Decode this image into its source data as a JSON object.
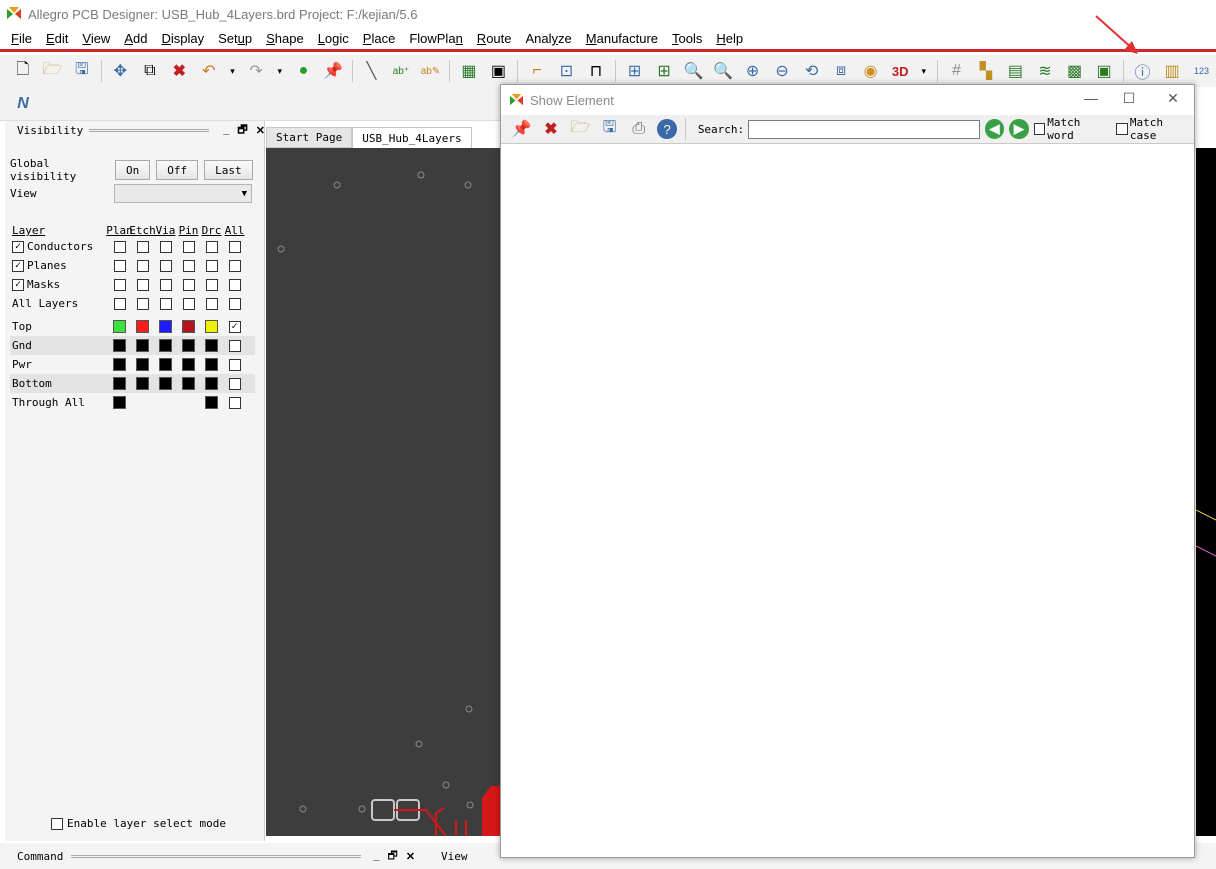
{
  "window": {
    "title": "Allegro PCB Designer: USB_Hub_4Layers.brd  Project: F:/kejian/5.6"
  },
  "menu": [
    {
      "label": "File",
      "u": "F"
    },
    {
      "label": "Edit",
      "u": "E"
    },
    {
      "label": "View",
      "u": "V"
    },
    {
      "label": "Add",
      "u": "A"
    },
    {
      "label": "Display",
      "u": "D"
    },
    {
      "label": "Setup",
      "u": "u"
    },
    {
      "label": "Shape",
      "u": "S"
    },
    {
      "label": "Logic",
      "u": "L"
    },
    {
      "label": "Place",
      "u": "P"
    },
    {
      "label": "FlowPlan",
      "u": "n"
    },
    {
      "label": "Route",
      "u": "R"
    },
    {
      "label": "Analyze",
      "u": "y"
    },
    {
      "label": "Manufacture",
      "u": "M"
    },
    {
      "label": "Tools",
      "u": "T"
    },
    {
      "label": "Help",
      "u": "H"
    }
  ],
  "toolbar_icons": [
    "new-file",
    "open-folder",
    "save",
    "move",
    "copy",
    "delete",
    "undo",
    "dropdown",
    "redo",
    "dropdown",
    "color-ball",
    "pin",
    "line",
    "add-text",
    "edit-text",
    "properties",
    "component",
    "connect",
    "route-box",
    "route-step",
    "grid-a",
    "grid-b",
    "zoom-fit",
    "zoom-in",
    "zoom-plus",
    "zoom-minus",
    "zoom-prev",
    "zoom-box",
    "refresh",
    "3d",
    "grid",
    "layers",
    "layers-b",
    "stack",
    "panel",
    "panel-b",
    "info",
    "show-element",
    "ruler"
  ],
  "toolbar_3d_label": "3D",
  "toolbar_ruler_label": "123",
  "visibility": {
    "title": "Visibility",
    "header_btns": [
      "_",
      "🗗",
      "✕"
    ],
    "global_label": "Global visibility",
    "on": "On",
    "off": "Off",
    "last": "Last",
    "view_label": "View",
    "layer_header": "Layer",
    "col_headers": [
      "Plan",
      "Etch",
      "Via",
      "Pin",
      "Drc",
      "All"
    ],
    "groups": [
      {
        "label": "Conductors",
        "checked": true
      },
      {
        "label": "Planes",
        "checked": true
      },
      {
        "label": "Masks",
        "checked": true
      },
      {
        "label": "All Layers",
        "checked": false
      }
    ],
    "layers": [
      {
        "label": "Top",
        "colors": [
          "#3ee03e",
          "#ff1c1c",
          "#1c1cff",
          "#b3131d",
          "#f0f000"
        ],
        "all_checked": true
      },
      {
        "label": "Gnd",
        "colors": [
          "#000000",
          "#000000",
          "#000000",
          "#000000",
          "#000000"
        ],
        "all_checked": false
      },
      {
        "label": "Pwr",
        "colors": [
          "#000000",
          "#000000",
          "#000000",
          "#000000",
          "#000000"
        ],
        "all_checked": false
      },
      {
        "label": "Bottom",
        "colors": [
          "#000000",
          "#000000",
          "#000000",
          "#000000",
          "#000000"
        ],
        "all_checked": false
      },
      {
        "label": "Through All",
        "colors": [
          "#000000",
          null,
          null,
          null,
          "#000000"
        ],
        "all_checked": false
      }
    ],
    "enable_select": "Enable layer select mode"
  },
  "tabs": [
    "Start Page",
    "USB_Hub_4Layers"
  ],
  "command": {
    "label": "Command",
    "view_label": "View"
  },
  "dialog": {
    "title": "Show Element",
    "search_label": "Search:",
    "search_value": "",
    "match_word": "Match word",
    "match_case": "Match case"
  },
  "colors": {
    "accent_red": "#d4262a",
    "canvas": "#3d3d3d"
  }
}
